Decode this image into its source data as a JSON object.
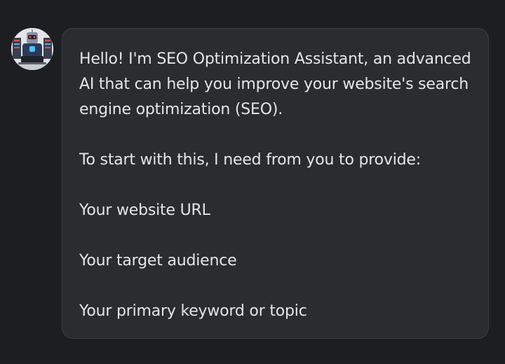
{
  "message": {
    "paragraphs": [
      "Hello! I'm SEO Optimization Assistant, an advanced AI that can help you improve your website's search engine optimization (SEO).",
      "To start with this, I need from you to provide:",
      "Your website URL",
      "Your target audience",
      "Your primary keyword or topic"
    ]
  },
  "avatar": {
    "icon": "robot-avatar-icon"
  },
  "colors": {
    "background": "#1d1e21",
    "bubble": "#2b2c30",
    "bubble_border": "#3c3d42",
    "text": "#e6e6e8"
  }
}
